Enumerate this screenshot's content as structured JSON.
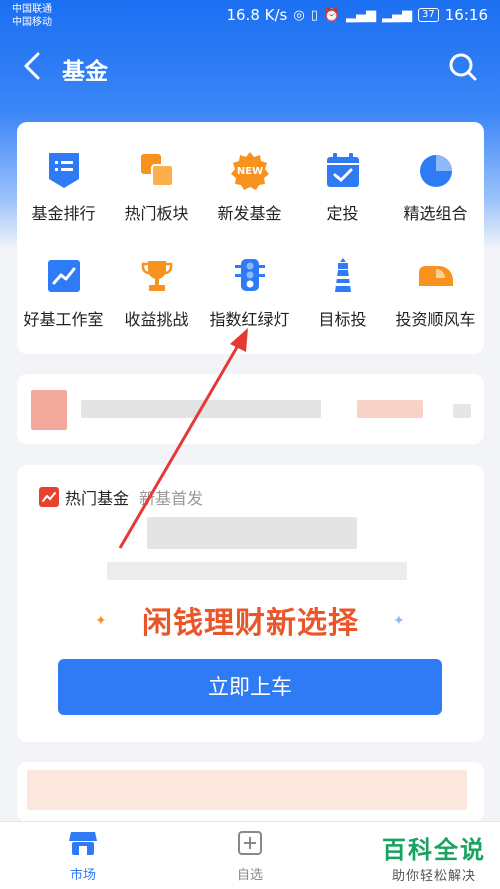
{
  "status_bar": {
    "carrier1": "中国联通",
    "carrier2": "中国移动",
    "speed": "16.8 K/s",
    "battery": "37",
    "time": "16:16"
  },
  "navbar": {
    "title": "基金"
  },
  "grid": [
    {
      "label": "基金排行",
      "icon": "ranking-list-icon"
    },
    {
      "label": "热门板块",
      "icon": "hot-sectors-icon"
    },
    {
      "label": "新发基金",
      "icon": "new-fund-icon",
      "badge": "NEW"
    },
    {
      "label": "定投",
      "icon": "calendar-check-icon"
    },
    {
      "label": "精选组合",
      "icon": "pie-chart-icon"
    },
    {
      "label": "好基工作室",
      "icon": "trend-chart-icon"
    },
    {
      "label": "收益挑战",
      "icon": "trophy-icon"
    },
    {
      "label": "指数红绿灯",
      "icon": "traffic-light-icon"
    },
    {
      "label": "目标投",
      "icon": "lighthouse-icon"
    },
    {
      "label": "投资顺风车",
      "icon": "car-icon"
    }
  ],
  "hot_card": {
    "title": "热门基金",
    "subtitle": "新基首发",
    "slogan": "闲钱理财新选择",
    "button": "立即上车"
  },
  "tabbar": {
    "tabs": [
      {
        "label": "市场"
      },
      {
        "label": "自选"
      }
    ]
  },
  "watermark": {
    "big": "百科全说",
    "small": "助你轻松解决"
  },
  "colors": {
    "primary": "#2f7af5",
    "accent": "#e8562a",
    "orange": "#f7921e"
  }
}
